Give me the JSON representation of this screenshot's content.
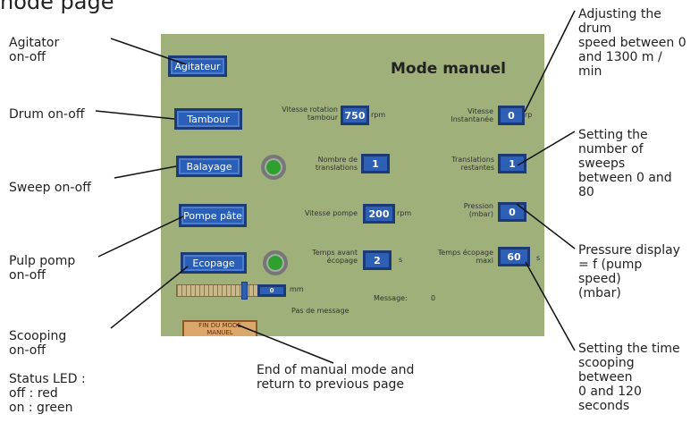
{
  "page_title": "node page",
  "annotations": {
    "agitator": "Agitator\non-off",
    "drum": "Drum on-off",
    "sweep": "Sweep on-off",
    "pulp": "Pulp pomp\non-off",
    "scooping": "Scooping\non-off",
    "status_led": "Status LED :\noff : red\non : green",
    "end_manual": "End of manual mode and\nreturn to previous page",
    "drum_speed": "Adjusting the\ndrum\nspeed between 0\nand 1300 m /\nmin",
    "sweeps": "Setting the\nnumber of\nsweeps\nbetween 0 and\n80",
    "pressure": "Pressure display\n= f (pump\nspeed)\n(mbar)",
    "time_scooping": "Setting the time\nscooping\nbetween\n0 and 120\nseconds"
  },
  "screen": {
    "title": "Mode manuel",
    "buttons": {
      "agitateur": "Agitateur",
      "tambour": "Tambour",
      "balayage": "Balayage",
      "pompe": "Pompe pâte",
      "ecopage": "Ecopage"
    },
    "fields": {
      "vitesse_rotation": {
        "label": "Vitesse rotation\ntambour",
        "value": "750",
        "unit": "rpm"
      },
      "vitesse_instantanee": {
        "label": "Vitesse\nInstantanée",
        "value": "0",
        "unit": "rp"
      },
      "nombre_translations": {
        "label": "Nombre de\ntranslations",
        "value": "1"
      },
      "translations_restantes": {
        "label": "Translations\nrestantes",
        "value": "1"
      },
      "vitesse_pompe": {
        "label": "Vitesse pompe",
        "value": "200",
        "unit": "rpm"
      },
      "pression": {
        "label": "Pression\n(mbar)",
        "value": "0"
      },
      "temps_avant": {
        "label": "Temps avant\nécopage",
        "value": "2",
        "unit": "s"
      },
      "temps_ecopage": {
        "label": "Temps écopage\nmaxi",
        "value": "60",
        "unit": "s"
      }
    },
    "slider": {
      "value": "0",
      "unit": "mm"
    },
    "message_label": "Message:",
    "message_value": "0",
    "no_message": "Pas de message",
    "end_button": "FIN DU MODE\nMANUEL",
    "colors": {
      "panel": "#9fb07a",
      "button": "#2a5fb8",
      "led_on": "#2ea02e"
    }
  }
}
